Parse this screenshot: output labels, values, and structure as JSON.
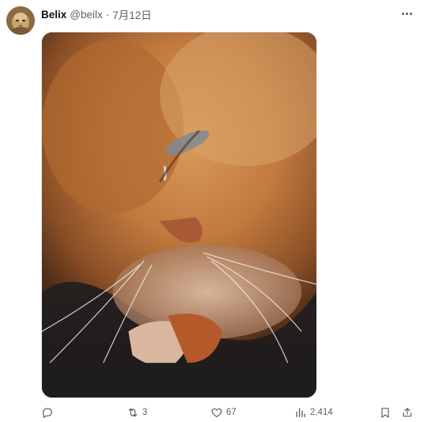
{
  "author": {
    "display_name": "Belix",
    "handle": "@beilx",
    "separator": "·",
    "date": "7月12日"
  },
  "media": {
    "description_icon": "cat-photo"
  },
  "actions": {
    "reply_count": "",
    "repost_count": "3",
    "like_count": "67",
    "views_count": "2,414"
  },
  "colors": {
    "muted_text": "#536471",
    "primary_text": "#0f1419"
  }
}
